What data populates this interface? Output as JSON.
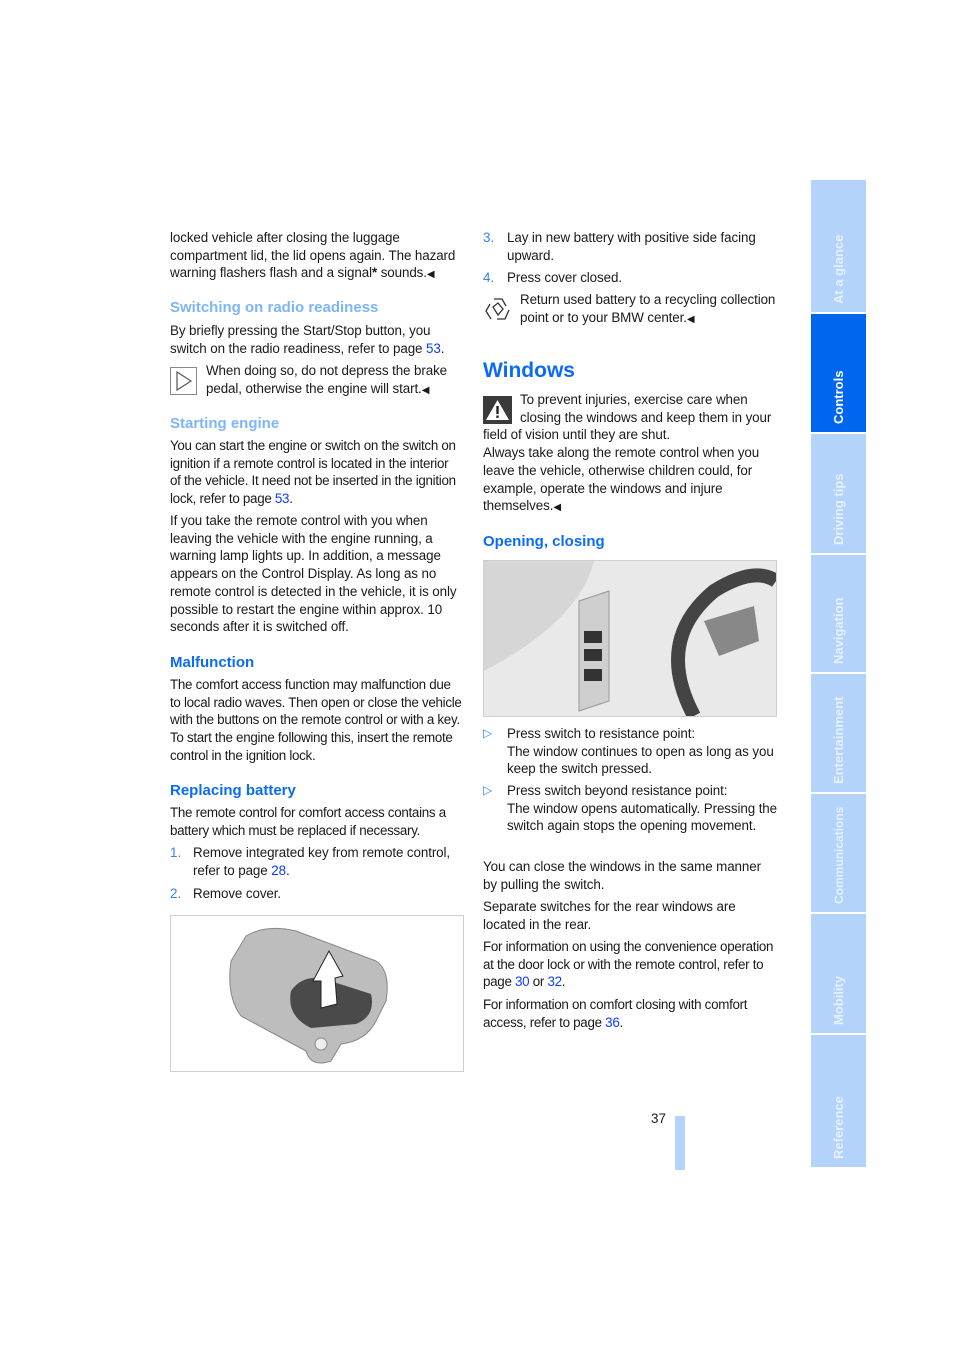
{
  "left": {
    "intro": "locked vehicle after closing the luggage compartment lid, the lid opens again. The hazard warning flashers flash and a signal",
    "intro_star": "*",
    "intro_end": " sounds.",
    "radio": {
      "heading": "Switching on radio readiness",
      "text": "By briefly pressing the Start/Stop button, you switch on the radio readiness, refer to page ",
      "page": "53",
      "note": "When doing so, do not depress the brake pedal, otherwise the engine will start."
    },
    "starting": {
      "heading": "Starting engine",
      "p1": "You can start the engine or switch on the switch on ignition if a remote control is located in the interior of the vehicle. It need not be inserted in the ignition lock, refer to page ",
      "p1_page": "53",
      "p2": "If you take the remote control with you when leaving the vehicle with the engine running, a warning lamp lights up. In addition, a message appears on the Control Display. As long as no remote control is detected in the vehicle, it is only possible to restart the engine within approx. 10 seconds after it is switched off."
    },
    "malfunction": {
      "heading": "Malfunction",
      "text": "The comfort access function may malfunction due to local radio waves. Then open or close the vehicle with the buttons on the remote control or with a key. To start the engine following this, insert the remote control in the ignition lock."
    },
    "battery": {
      "heading": "Replacing battery",
      "text": "The remote control for comfort access contains a battery which must be replaced if necessary.",
      "steps": [
        {
          "num": "1.",
          "text": "Remove integrated key from remote control, refer to page ",
          "page": "28"
        },
        {
          "num": "2.",
          "text": "Remove cover."
        }
      ]
    }
  },
  "right": {
    "steps": [
      {
        "num": "3.",
        "text": "Lay in new battery with positive side facing upward."
      },
      {
        "num": "4.",
        "text": "Press cover closed."
      }
    ],
    "recycle_note": "Return used battery to a recycling collection point or to your BMW center.",
    "windows": {
      "heading": "Windows",
      "warning": "To prevent injuries, exercise care when closing the windows and keep them in your field of vision until they are shut.",
      "warning2": "Always take along the remote control when you leave the vehicle, otherwise children could, for example, operate the windows and injure themselves."
    },
    "opening": {
      "heading": "Opening, closing",
      "bullets": [
        {
          "title": "Press switch to resistance point:",
          "text": "The window continues to open as long as you keep the switch pressed."
        },
        {
          "title": "Press switch beyond resistance point:",
          "text": "The window opens automatically. Pressing the switch again stops the opening movement."
        }
      ],
      "p1": "You can close the windows in the same manner by pulling the switch.",
      "p2": "Separate switches for the rear windows are located in the rear.",
      "p3": "For information on using the convenience operation at the door lock or with the remote control, refer to page ",
      "p3_page1": "30",
      "p3_or": " or ",
      "p3_page2": "32",
      "p4": "For information on comfort closing with comfort access, refer to page ",
      "p4_page": "36"
    }
  },
  "page_number": "37",
  "tabs": [
    {
      "label": "At a glance",
      "active": false
    },
    {
      "label": "Controls",
      "active": true
    },
    {
      "label": "Driving tips",
      "active": false
    },
    {
      "label": "Navigation",
      "active": false
    },
    {
      "label": "Entertainment",
      "active": false
    },
    {
      "label": "Communications",
      "active": false
    },
    {
      "label": "Mobility",
      "active": false
    },
    {
      "label": "Reference",
      "active": false
    }
  ],
  "colors": {
    "heading": "#0a6cf2",
    "heading_light": "#7db5f9",
    "tab": "#b3d3fb",
    "tab_active": "#0066f0",
    "link": "#0a3cff"
  },
  "end_mark": "◀",
  "bullet_mark": "▷"
}
